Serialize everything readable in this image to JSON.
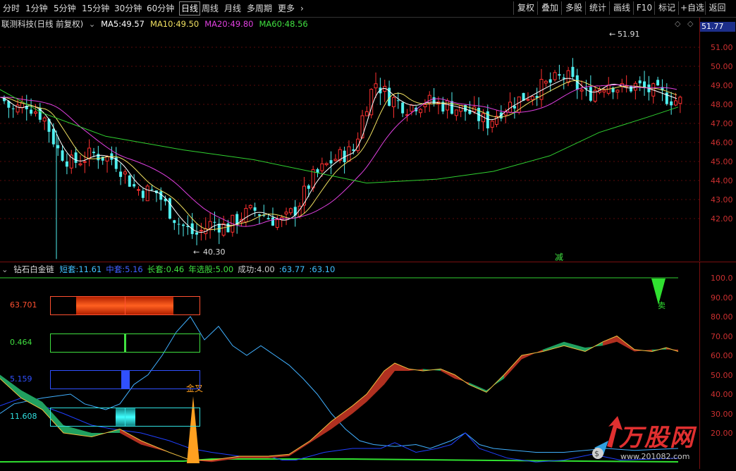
{
  "toolbar": {
    "periods": [
      "分时",
      "1分钟",
      "5分钟",
      "15分钟",
      "30分钟",
      "60分钟",
      "日线",
      "周线",
      "月线",
      "多周期",
      "更多"
    ],
    "active_period": "日线",
    "buttons": [
      "复权",
      "叠加",
      "多股",
      "统计",
      "画线",
      "F10",
      "标记",
      "+自选",
      "返回"
    ]
  },
  "main_panel": {
    "title": "联测科技(日线 前复权)",
    "ma": [
      {
        "label": "MA5:",
        "value": "49.57",
        "color": "#ffffff"
      },
      {
        "label": "MA10:",
        "value": "49.50",
        "color": "#f0e060"
      },
      {
        "label": "MA20:",
        "value": "49.80",
        "color": "#e040e0"
      },
      {
        "label": "MA60:",
        "value": "48.56",
        "color": "#40e040"
      }
    ],
    "current_price": "51.77",
    "y_ticks": [
      "51.00",
      "50.00",
      "49.00",
      "48.00",
      "47.00",
      "46.00",
      "45.00",
      "44.00",
      "43.00",
      "42.00"
    ],
    "high_annotation": "51.91",
    "low_annotation": "40.30",
    "marker": "减"
  },
  "indicator_panel": {
    "title": "钻石白金链",
    "items": [
      {
        "label": "短套:",
        "value": "11.61",
        "color": "#40c0ff"
      },
      {
        "label": "中套:",
        "value": "5.16",
        "color": "#4060ff"
      },
      {
        "label": "长套:",
        "value": "0.46",
        "color": "#40e040"
      },
      {
        "label": "年选股:",
        "value": "5.00",
        "color": "#40e040"
      },
      {
        "label": "成功:",
        "value": "4.00",
        "color": "#cccccc"
      },
      {
        "label": ":",
        "value": "63.77",
        "color": "#40c0ff"
      },
      {
        "label": ":",
        "value": "63.10",
        "color": "#40c0ff"
      }
    ],
    "y_ticks": [
      "100.0",
      "90.00",
      "80.00",
      "70.00",
      "60.00",
      "50.00",
      "40.00",
      "30.00",
      "20.00"
    ],
    "boxes": [
      {
        "value": "63.701",
        "color": "#ff5030",
        "fill": 0.7
      },
      {
        "value": "0.464",
        "color": "#40e040",
        "fill": 0.5
      },
      {
        "value": "5.159",
        "color": "#3050ff",
        "fill": 0.5
      },
      {
        "value": "11.608",
        "color": "#30e0e0",
        "fill": 0.5
      }
    ],
    "golden_cross": "金叉",
    "sell_mark": "卖"
  },
  "watermark": {
    "brand": "万股网",
    "url": "www.201082.com"
  }
}
